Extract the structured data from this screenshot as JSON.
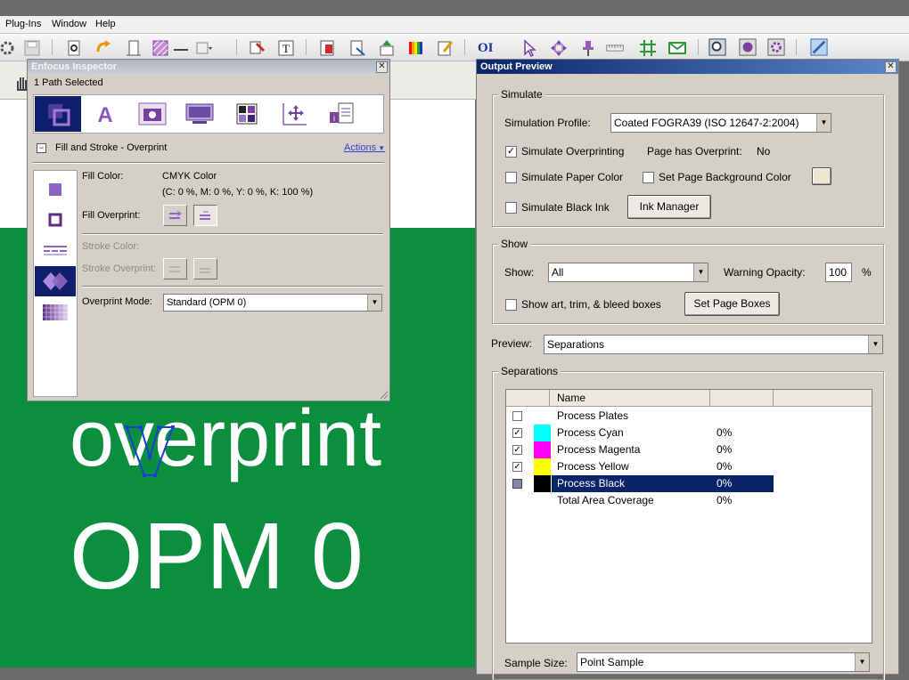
{
  "menu": {
    "items": [
      "Plug-Ins",
      "Window",
      "Help"
    ]
  },
  "toolbar": {
    "ocr_label": "OI"
  },
  "document": {
    "line1": "overprint",
    "line2": "OPM 0"
  },
  "inspector": {
    "title": "Enfocus Inspector",
    "selection_status": "1 Path Selected",
    "section_title": "Fill and Stroke - Overprint",
    "actions_label": "Actions",
    "tabs": [
      "fill-stroke",
      "text",
      "image",
      "document",
      "color",
      "position",
      "prepress"
    ],
    "fill_color_label": "Fill Color:",
    "fill_color_value": "CMYK Color",
    "fill_color_detail": "(C: 0 %, M: 0 %, Y: 0 %, K: 100 %)",
    "fill_overprint_label": "Fill Overprint:",
    "stroke_color_label": "Stroke Color:",
    "stroke_overprint_label": "Stroke Overprint:",
    "overprint_mode_label": "Overprint Mode:",
    "overprint_mode_value": "Standard (OPM 0)"
  },
  "output_preview": {
    "title": "Output Preview",
    "simulate": {
      "group_title": "Simulate",
      "profile_label": "Simulation Profile:",
      "profile_value": "Coated FOGRA39 (ISO 12647-2:2004)",
      "simulate_overprinting_label": "Simulate Overprinting",
      "simulate_overprinting_checked": true,
      "page_has_overprint_label": "Page has Overprint:",
      "page_has_overprint_value": "No",
      "simulate_paper_color_label": "Simulate Paper Color",
      "set_page_bg_label": "Set Page Background Color",
      "simulate_black_ink_label": "Simulate Black Ink",
      "ink_manager_label": "Ink Manager"
    },
    "show": {
      "group_title": "Show",
      "show_label": "Show:",
      "show_value": "All",
      "warning_opacity_label": "Warning Opacity:",
      "warning_opacity_value": "100",
      "percent": "%",
      "show_boxes_label": "Show art, trim, & bleed boxes",
      "set_page_boxes_label": "Set Page Boxes"
    },
    "preview": {
      "label": "Preview:",
      "value": "Separations"
    },
    "separations": {
      "group_title": "Separations",
      "col_name": "Name",
      "rows": [
        {
          "name": "Process Plates",
          "checked": false,
          "swatch": "",
          "value": ""
        },
        {
          "name": "Process Cyan",
          "checked": true,
          "swatch": "#00ffff",
          "value": "0%"
        },
        {
          "name": "Process Magenta",
          "checked": true,
          "swatch": "#ff00ff",
          "value": "0%"
        },
        {
          "name": "Process Yellow",
          "checked": true,
          "swatch": "#ffff00",
          "value": "0%"
        },
        {
          "name": "Process Black",
          "checked": true,
          "swatch": "#000000",
          "value": "0%",
          "selected": true
        },
        {
          "name": "Total Area Coverage",
          "checked": null,
          "swatch": "",
          "value": "0%"
        }
      ]
    },
    "sample_size": {
      "label": "Sample Size:",
      "value": "Point Sample"
    }
  },
  "colors": {
    "selection": "#0a246a",
    "doc_green": "#0b8f3e",
    "accent_purple": "#7b3fa0"
  }
}
